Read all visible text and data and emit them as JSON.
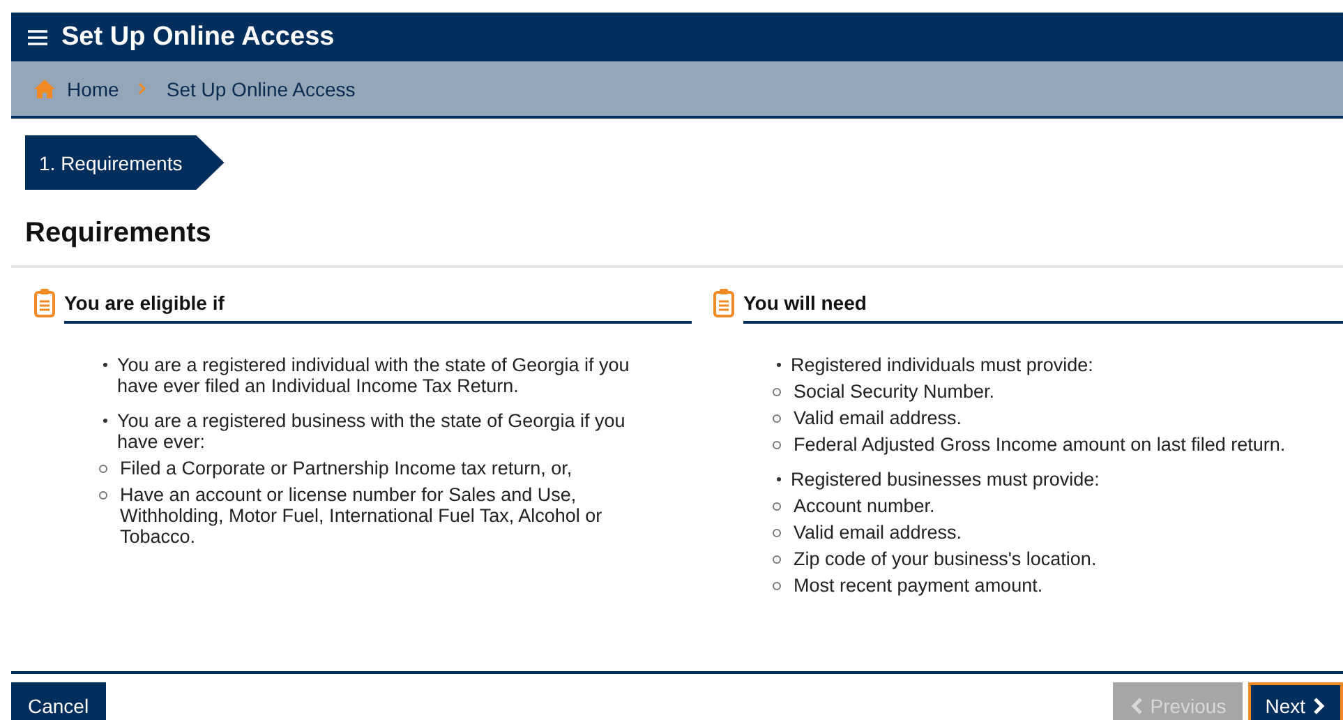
{
  "header": {
    "title": "Set Up Online Access"
  },
  "breadcrumb": [
    {
      "label": "Home",
      "kind": "home"
    },
    {
      "label": "Set Up Online Access",
      "kind": "page"
    }
  ],
  "steps": [
    {
      "label": "1. Requirements",
      "selected": true
    }
  ],
  "heading": "Requirements",
  "sections": [
    {
      "title": "You are eligible if",
      "items": [
        {
          "text": "You are a registered individual with the state of Georgia if you have ever filed an Individual Income Tax Return."
        },
        {
          "text": "You are a registered business with the state of Georgia if you have ever:",
          "children": [
            {
              "text": "Filed a Corporate or Partnership Income tax return, or,"
            },
            {
              "text": "Have an account or license number for Sales and Use, Withholding, Motor Fuel, International Fuel Tax, Alcohol or Tobacco."
            }
          ]
        }
      ]
    },
    {
      "title": "You will need",
      "items": [
        {
          "text": "Registered individuals must provide:",
          "children": [
            {
              "text": "Social Security Number."
            },
            {
              "text": "Valid email address."
            },
            {
              "text": "Federal Adjusted Gross Income amount on last filed return."
            }
          ]
        },
        {
          "text": "Registered businesses must provide:",
          "children": [
            {
              "text": "Account number."
            },
            {
              "text": "Valid email address."
            },
            {
              "text": "Zip code of your business's location."
            },
            {
              "text": "Most recent payment amount."
            }
          ]
        }
      ]
    }
  ],
  "buttons": [
    {
      "label": "Cancel",
      "kind": "cancel",
      "disabled": false,
      "focused": false
    },
    {
      "label": "Previous",
      "kind": "previous",
      "disabled": true,
      "focused": false
    },
    {
      "label": "Next",
      "kind": "next",
      "disabled": false,
      "focused": true
    }
  ]
}
